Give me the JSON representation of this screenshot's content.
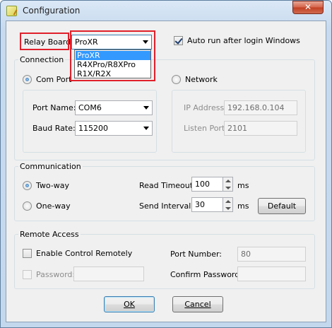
{
  "window": {
    "title": "Configuration",
    "close_glyph": "✕"
  },
  "relay_board": {
    "label": "Relay Board:",
    "selected": "ProXR",
    "options": [
      "ProXR",
      "R4XPro/R8XPro",
      "R1X/R2X"
    ]
  },
  "auto_run": {
    "label": "Auto run after login Windows",
    "checked": true
  },
  "connection": {
    "title": "Connection",
    "com_port": {
      "label": "Com Port",
      "selected": true
    },
    "network": {
      "label": "Network",
      "selected": false
    },
    "port_name": {
      "label": "Port Name:",
      "value": "COM6"
    },
    "baud_rate": {
      "label": "Baud Rate:",
      "value": "115200"
    },
    "ip_address": {
      "label": "IP Address:",
      "value": "192.168.0.104"
    },
    "listen_port": {
      "label": "Listen Port:",
      "value": "2101"
    }
  },
  "communication": {
    "title": "Communication",
    "two_way": {
      "label": "Two-way",
      "selected": true
    },
    "one_way": {
      "label": "One-way",
      "selected": false
    },
    "read_timeout": {
      "label": "Read Timeout:",
      "value": "100",
      "unit": "ms"
    },
    "send_interval": {
      "label": "Send Interval:",
      "value": "30",
      "unit": "ms"
    },
    "default_button": "Default"
  },
  "remote_access": {
    "title": "Remote Access",
    "enable_control": {
      "label": "Enable Control Remotely",
      "checked": false
    },
    "password": {
      "label": "Password:",
      "value": "",
      "checked": false
    },
    "port_number": {
      "label": "Port Number:",
      "value": "80"
    },
    "confirm_password": {
      "label": "Confirm Password:",
      "value": ""
    }
  },
  "buttons": {
    "ok": "OK",
    "cancel": "Cancel"
  },
  "colors": {
    "highlight": "#e0202a",
    "selection": "#3399ff"
  }
}
